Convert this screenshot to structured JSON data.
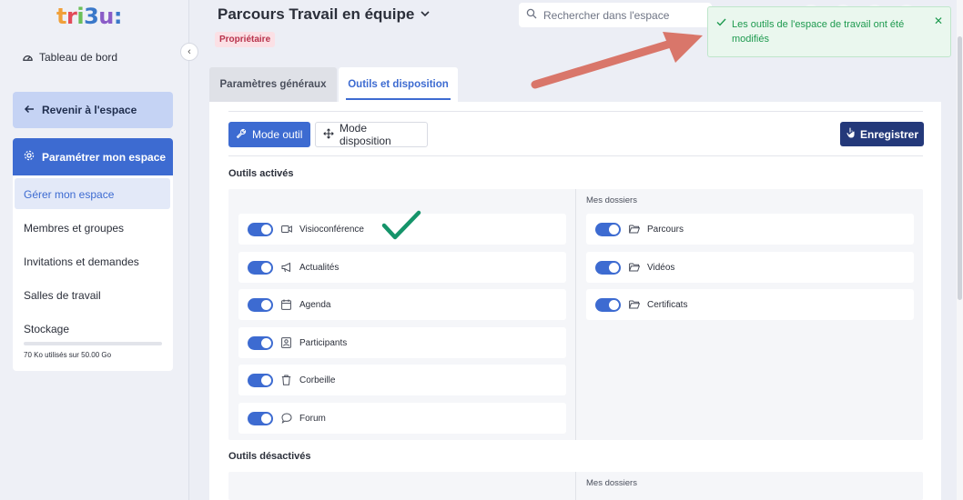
{
  "app": {
    "logo": "tri3u:"
  },
  "sidebar": {
    "dashboard": "Tableau de bord",
    "back": "Revenir à l'espace",
    "configure": "Paramétrer mon espace",
    "items": [
      {
        "label": "Gérer mon espace"
      },
      {
        "label": "Membres et groupes"
      },
      {
        "label": "Invitations et demandes"
      },
      {
        "label": "Salles de travail"
      },
      {
        "label": "Stockage"
      }
    ],
    "storage_text": "70 Ko utilisés sur 50.00 Go",
    "storage_fraction": 0.0
  },
  "header": {
    "title": "Parcours Travail en équipe",
    "role_badge": "Propriétaire",
    "search_placeholder": "Rechercher dans l'espace"
  },
  "tabs": [
    {
      "label": "Paramètres généraux"
    },
    {
      "label": "Outils et disposition"
    }
  ],
  "toolbar": {
    "mode_tool": "Mode outil",
    "mode_layout": "Mode disposition",
    "save": "Enregistrer"
  },
  "active": {
    "title": "Outils activés",
    "folders_label": "Mes dossiers",
    "tools": [
      {
        "label": "Visioconférence",
        "icon": "video-icon",
        "enabled": true
      },
      {
        "label": "Actualités",
        "icon": "megaphone-icon",
        "enabled": true
      },
      {
        "label": "Agenda",
        "icon": "calendar-icon",
        "enabled": true
      },
      {
        "label": "Participants",
        "icon": "contact-icon",
        "enabled": true
      },
      {
        "label": "Corbeille",
        "icon": "trash-icon",
        "enabled": true
      },
      {
        "label": "Forum",
        "icon": "chat-icon",
        "enabled": true
      }
    ],
    "folders": [
      {
        "label": "Parcours",
        "icon": "folder-icon",
        "enabled": true
      },
      {
        "label": "Vidéos",
        "icon": "folder-icon",
        "enabled": true
      },
      {
        "label": "Certificats",
        "icon": "folder-icon",
        "enabled": true
      }
    ]
  },
  "inactive": {
    "title": "Outils désactivés",
    "folders_label": "Mes dossiers"
  },
  "toast": {
    "message": "Les outils de l'espace de travail ont été modifiés",
    "close": "✕"
  },
  "colors": {
    "primary": "#3d6bd1",
    "dark_button": "#24397a",
    "success": "#1e9a4f",
    "badge": "#b8324b"
  }
}
